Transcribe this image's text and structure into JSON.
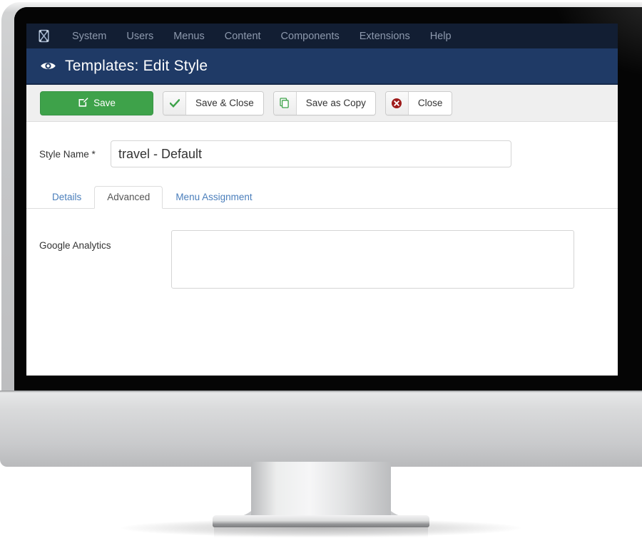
{
  "topnav": {
    "logo_icon": "joomla-logo-icon",
    "items": [
      {
        "label": "System"
      },
      {
        "label": "Users"
      },
      {
        "label": "Menus"
      },
      {
        "label": "Content"
      },
      {
        "label": "Components"
      },
      {
        "label": "Extensions"
      },
      {
        "label": "Help"
      }
    ],
    "background_color": "#121e33",
    "text_color": "#8d99ad"
  },
  "header": {
    "icon": "eye-icon",
    "title": "Templates: Edit Style",
    "background_color": "#1f3a66"
  },
  "toolbar": {
    "background_color": "#efefef",
    "save": {
      "label": "Save",
      "icon": "edit-pencil-icon",
      "color": "#3ea24a"
    },
    "save_close": {
      "label": "Save & Close",
      "icon": "check-icon",
      "icon_color": "#3ea24a"
    },
    "save_copy": {
      "label": "Save as Copy",
      "icon": "copy-icon",
      "icon_color": "#3ea24a"
    },
    "close": {
      "label": "Close",
      "icon": "cancel-circle-icon",
      "icon_color": "#9e1b1b"
    }
  },
  "form": {
    "style_name": {
      "label": "Style Name *",
      "value": "travel - Default",
      "placeholder": ""
    },
    "google_analytics": {
      "label": "Google Analytics",
      "value": "",
      "placeholder": ""
    }
  },
  "tabs": [
    {
      "label": "Details",
      "active": false
    },
    {
      "label": "Advanced",
      "active": true
    },
    {
      "label": "Menu Assignment",
      "active": false
    }
  ]
}
